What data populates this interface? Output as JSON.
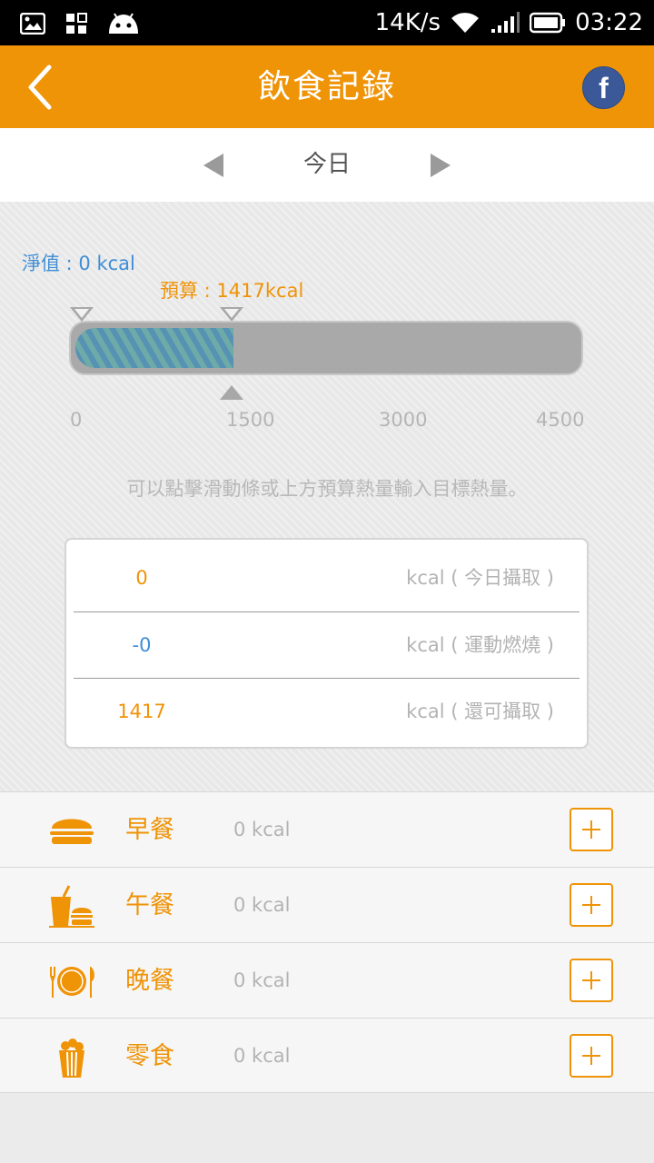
{
  "status_bar": {
    "net_speed": "14K/s",
    "time": "03:22",
    "icons": [
      "image-icon",
      "apps-icon",
      "android-icon",
      "wifi-icon",
      "signal-icon",
      "battery-icon"
    ]
  },
  "header": {
    "title": "飲食記錄",
    "back_icon": "chevron-left-icon",
    "share_icon": "facebook-icon",
    "facebook_glyph": "f",
    "accent_color": "#ef9307"
  },
  "date_nav": {
    "label": "今日",
    "prev_icon": "triangle-left-icon",
    "next_icon": "triangle-right-icon"
  },
  "gauge": {
    "net_label": "淨值 : 0 kcal",
    "budget_label": "預算 : 1417kcal",
    "net_value": 0,
    "budget_value": 1417,
    "max_value": 4500,
    "ticks": [
      "0",
      "1500",
      "3000",
      "4500"
    ],
    "hint": "可以點擊滑動條或上方預算熱量輸入目標熱量。"
  },
  "summary": {
    "rows": [
      {
        "value": "0",
        "desc": "kcal ( 今日攝取 )",
        "color": "#ef9307"
      },
      {
        "value": "-0",
        "desc": "kcal ( 運動燃燒 )",
        "color": "#3f8ed6"
      },
      {
        "value": "1417",
        "desc": "kcal ( 還可攝取 )",
        "color": "#ef9307"
      }
    ]
  },
  "meals": [
    {
      "name": "早餐",
      "kcal": "0  kcal",
      "icon": "burger-icon"
    },
    {
      "name": "午餐",
      "kcal": "0  kcal",
      "icon": "drink-burger-icon"
    },
    {
      "name": "晚餐",
      "kcal": "0  kcal",
      "icon": "plate-fork-knife-icon"
    },
    {
      "name": "零食",
      "kcal": "0  kcal",
      "icon": "popcorn-icon"
    }
  ]
}
